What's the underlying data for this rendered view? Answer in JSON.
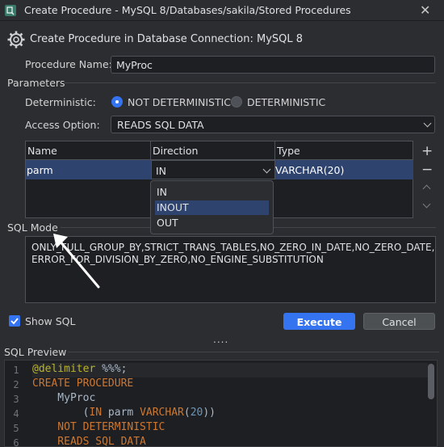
{
  "window": {
    "title": "Create Procedure - MySQL 8/Databases/sakila/Stored Procedures",
    "header": "Create Procedure in Database Connection: MySQL 8"
  },
  "form": {
    "procedure_name_label": "Procedure Name:",
    "procedure_name_value": "MyProc",
    "parameters_title": "Parameters",
    "deterministic_label": "Deterministic:",
    "not_deterministic": "NOT DETERMINISTIC",
    "deterministic": "DETERMINISTIC",
    "access_option_label": "Access Option:",
    "access_option_value": "READS SQL DATA"
  },
  "params_table": {
    "columns": [
      "Name",
      "Direction",
      "Type"
    ],
    "row": {
      "name": "parm",
      "direction": "IN",
      "type": "VARCHAR(20)"
    },
    "side_buttons": {
      "add": "+",
      "remove": "−"
    }
  },
  "direction_dropdown": {
    "options": [
      "IN",
      "INOUT",
      "OUT"
    ],
    "highlighted": "INOUT"
  },
  "sql_mode": {
    "title": "SQL Mode",
    "line1": "ONLY_FULL_GROUP_BY,STRICT_TRANS_TABLES,NO_ZERO_IN_DATE,NO_ZERO_DATE,",
    "line2": "ERROR_FOR_DIVISION_BY_ZERO,NO_ENGINE_SUBSTITUTION"
  },
  "actions": {
    "show_sql_label": "Show SQL",
    "execute": "Execute",
    "cancel": "Cancel",
    "divider": "...."
  },
  "preview": {
    "title": "SQL Preview",
    "line_numbers": [
      "1",
      "2",
      "3",
      "4",
      "5",
      "6"
    ],
    "lines": {
      "l1_ann": "@delimiter",
      "l1_rest": " %%%;",
      "l2": "CREATE PROCEDURE",
      "l3": "    MyProc",
      "l4_a": "        (",
      "l4_in": "IN",
      "l4_b": " parm ",
      "l4_type": "VARCHAR",
      "l4_c": "(",
      "l4_num": "20",
      "l4_d": "))",
      "l5": "    NOT DETERMINISTIC",
      "l6": "    READS SQL DATA"
    }
  },
  "colors": {
    "accent": "#3574f0",
    "selection": "#2e436e",
    "keyword": "#cc7832"
  }
}
